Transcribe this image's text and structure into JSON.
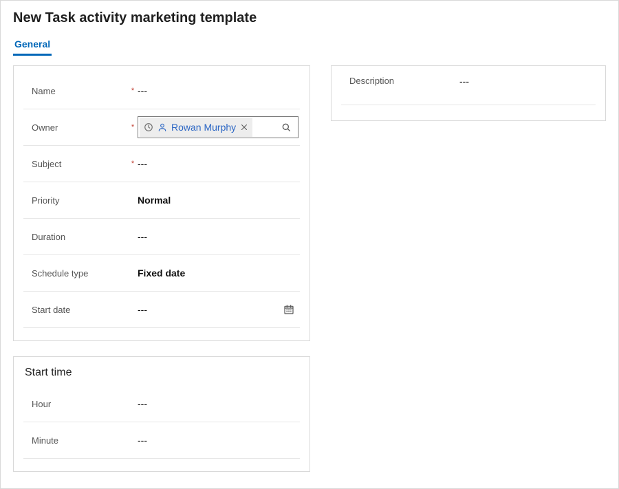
{
  "page": {
    "title": "New Task activity marketing template"
  },
  "tabs": {
    "general": "General"
  },
  "placeholders": {
    "empty": "---"
  },
  "left": {
    "name": {
      "label": "Name",
      "required": "*",
      "value": "---"
    },
    "owner": {
      "label": "Owner",
      "required": "*",
      "chip_text": "Rowan Murphy"
    },
    "subject": {
      "label": "Subject",
      "required": "*",
      "value": "---"
    },
    "priority": {
      "label": "Priority",
      "value": "Normal"
    },
    "duration": {
      "label": "Duration",
      "value": "---"
    },
    "schedule_type": {
      "label": "Schedule type",
      "value": "Fixed date"
    },
    "start_date": {
      "label": "Start date",
      "value": "---"
    }
  },
  "right": {
    "description": {
      "label": "Description",
      "value": "---"
    }
  },
  "time_section": {
    "title": "Start time",
    "hour": {
      "label": "Hour",
      "value": "---"
    },
    "minute": {
      "label": "Minute",
      "value": "---"
    }
  }
}
